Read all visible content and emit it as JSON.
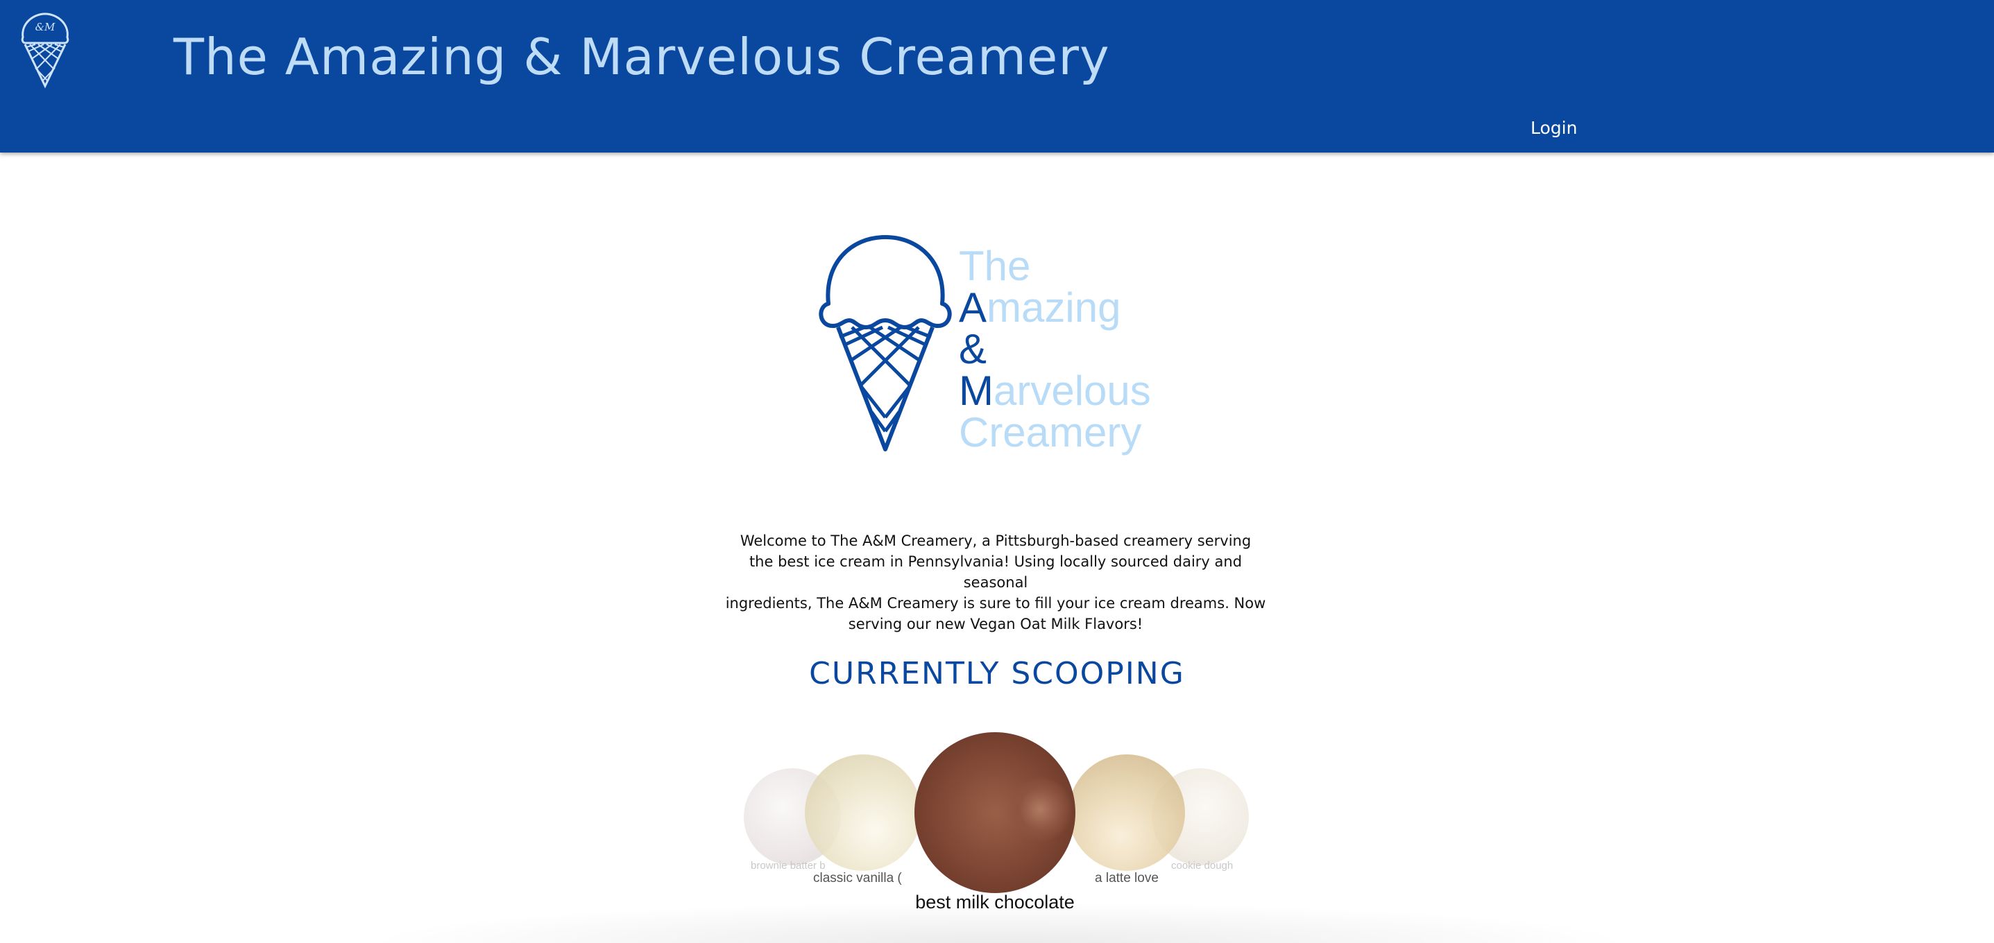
{
  "header": {
    "title": "The Amazing & Marvelous Creamery",
    "login_label": "Login",
    "logo_icon": "ice-cream-cone-icon",
    "logo_text": "&M"
  },
  "hero": {
    "logo_icon": "ice-cream-cone-icon",
    "logo_lines": [
      {
        "initial": "",
        "rest": "The"
      },
      {
        "initial": "A",
        "rest": "mazing"
      },
      {
        "initial": "&",
        "rest": ""
      },
      {
        "initial": "M",
        "rest": "arvelous"
      },
      {
        "initial": "",
        "rest": "Creamery"
      }
    ]
  },
  "welcome": {
    "lines": [
      "Welcome to The A&M Creamery, a Pittsburgh-based creamery serving",
      "the best ice cream in Pennsylvania! Using locally sourced dairy and seasonal",
      "ingredients, The A&M Creamery is sure to fill your ice cream dreams. Now",
      "serving our new Vegan Oat Milk Flavors!"
    ]
  },
  "scooping": {
    "heading": "CURRENTLY SCOOPING",
    "flavors": [
      {
        "label": "brownie batter b",
        "state": "far-left"
      },
      {
        "label": "classic vanilla (",
        "state": "left"
      },
      {
        "label": "best milk chocolate",
        "state": "active"
      },
      {
        "label": "a latte love",
        "state": "right"
      },
      {
        "label": "cookie dough",
        "state": "far-right"
      }
    ]
  },
  "colors": {
    "brand_blue": "#0a48a0",
    "title_light_blue": "#bfdcf7",
    "logo_light_blue": "#b8dbf7"
  }
}
